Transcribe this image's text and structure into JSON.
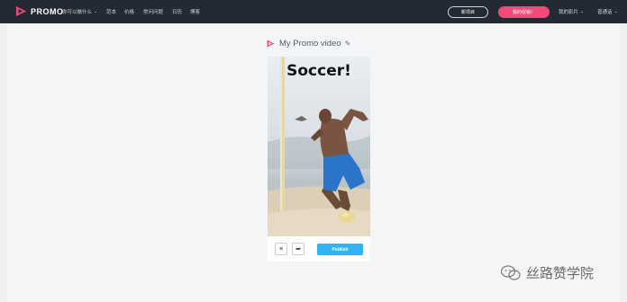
{
  "topnav": {
    "brand": "PROMO",
    "menu": [
      {
        "label": "你可以做什么",
        "dropdown": true
      },
      {
        "label": "范本",
        "dropdown": false
      },
      {
        "label": "价格",
        "dropdown": false
      },
      {
        "label": "常问问题",
        "dropdown": false
      },
      {
        "label": "日历",
        "dropdown": false
      },
      {
        "label": "博客",
        "dropdown": false
      }
    ],
    "new_project_label": "新项目",
    "upgrade_label": "我的促销！",
    "my_videos_label": "我的影片",
    "language_label": "普通话"
  },
  "editor": {
    "video_title": "My Promo video",
    "preview_headline": "Soccer!",
    "publish_label": "Publish"
  },
  "watermark": {
    "text": "丝路赞学院"
  },
  "colors": {
    "nav_bg": "#242a33",
    "brand_pink": "#f14a7a",
    "publish_blue": "#2fb3f3",
    "page_bg": "#f4f5f6"
  }
}
